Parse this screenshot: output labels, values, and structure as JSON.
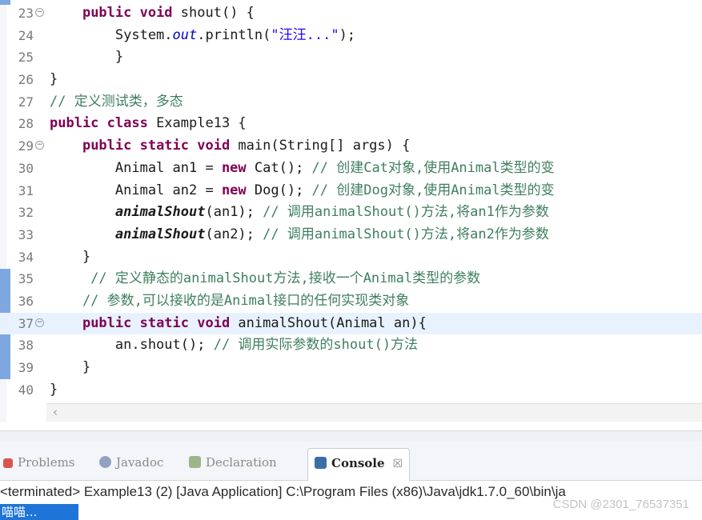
{
  "editor": {
    "lines": [
      {
        "num": "23",
        "fold": true,
        "segs": [
          [
            "    ",
            ""
          ],
          [
            "public void",
            "kw"
          ],
          [
            " shout() {",
            ""
          ]
        ]
      },
      {
        "num": "24",
        "fold": false,
        "segs": [
          [
            "        System.",
            ""
          ],
          [
            "out",
            "fi"
          ],
          [
            ".println(",
            ""
          ],
          [
            "\"汪汪...\"",
            "st"
          ],
          [
            ");",
            ""
          ]
        ]
      },
      {
        "num": "25",
        "fold": false,
        "segs": [
          [
            "        }",
            ""
          ]
        ]
      },
      {
        "num": "26",
        "fold": false,
        "segs": [
          [
            "}",
            ""
          ]
        ]
      },
      {
        "num": "27",
        "fold": false,
        "segs": [
          [
            "// 定义测试类，多态",
            "cm"
          ]
        ]
      },
      {
        "num": "28",
        "fold": false,
        "segs": [
          [
            "public class",
            "kw"
          ],
          [
            " Example13 {",
            ""
          ]
        ]
      },
      {
        "num": "29",
        "fold": true,
        "segs": [
          [
            "    ",
            ""
          ],
          [
            "public static void",
            "kw"
          ],
          [
            " main(String[] args) {",
            ""
          ]
        ]
      },
      {
        "num": "30",
        "fold": false,
        "segs": [
          [
            "        Animal an1 = ",
            ""
          ],
          [
            "new",
            "kw"
          ],
          [
            " Cat(); ",
            ""
          ],
          [
            "// 创建Cat对象,使用Animal类型的变",
            "cm"
          ]
        ]
      },
      {
        "num": "31",
        "fold": false,
        "segs": [
          [
            "        Animal an2 = ",
            ""
          ],
          [
            "new",
            "kw"
          ],
          [
            " Dog(); ",
            ""
          ],
          [
            "// 创建Dog对象,使用Animal类型的变",
            "cm"
          ]
        ]
      },
      {
        "num": "32",
        "fold": false,
        "segs": [
          [
            "        ",
            ""
          ],
          [
            "animalShout",
            "mi"
          ],
          [
            "(an1); ",
            ""
          ],
          [
            "// 调用animalShout()方法,将an1作为参数",
            "cm"
          ]
        ]
      },
      {
        "num": "33",
        "fold": false,
        "segs": [
          [
            "        ",
            ""
          ],
          [
            "animalShout",
            "mi"
          ],
          [
            "(an2); ",
            ""
          ],
          [
            "// 调用animalShout()方法,将an2作为参数",
            "cm"
          ]
        ]
      },
      {
        "num": "34",
        "fold": false,
        "segs": [
          [
            "    }",
            ""
          ]
        ]
      },
      {
        "num": "35",
        "fold": false,
        "segs": [
          [
            "     // 定义静态的animalShout方法,接收一个Animal类型的参数",
            "cm"
          ]
        ]
      },
      {
        "num": "36",
        "fold": false,
        "segs": [
          [
            "    // 参数,可以接收的是Animal接口的任何实现类对象",
            "cm"
          ]
        ]
      },
      {
        "num": "37",
        "fold": true,
        "current": true,
        "segs": [
          [
            "    ",
            ""
          ],
          [
            "public static void",
            "kw"
          ],
          [
            " animalShout(Animal an){",
            ""
          ]
        ]
      },
      {
        "num": "38",
        "fold": false,
        "segs": [
          [
            "        an.shout(); ",
            ""
          ],
          [
            "// 调用实际参数的shout()方法",
            "cm"
          ]
        ]
      },
      {
        "num": "39",
        "fold": false,
        "segs": [
          [
            "    }",
            ""
          ]
        ]
      },
      {
        "num": "40",
        "fold": false,
        "segs": [
          [
            "}",
            ""
          ]
        ]
      }
    ]
  },
  "tabs": {
    "problems": "Problems",
    "javadoc": "Javadoc",
    "declaration": "Declaration",
    "console": "Console"
  },
  "console": {
    "header": "<terminated> Example13 (2) [Java Application] C:\\Program Files (x86)\\Java\\jdk1.7.0_60\\bin\\ja",
    "output": "喵喵..."
  },
  "watermark": "CSDN @2301_76537351",
  "colors": {
    "keyword": "#7f0055",
    "string": "#2a00ff",
    "comment": "#3f7f5f",
    "field": "#0000c0",
    "current_line": "#e8f2fe",
    "console_selection": "#1f74d8"
  },
  "icons": {
    "problems": "problems-icon",
    "javadoc": "javadoc-icon",
    "declaration": "declaration-icon",
    "console": "console-icon",
    "close": "close-icon",
    "scroll_left": "scroll-left-icon",
    "fold": "fold-toggle-icon"
  }
}
